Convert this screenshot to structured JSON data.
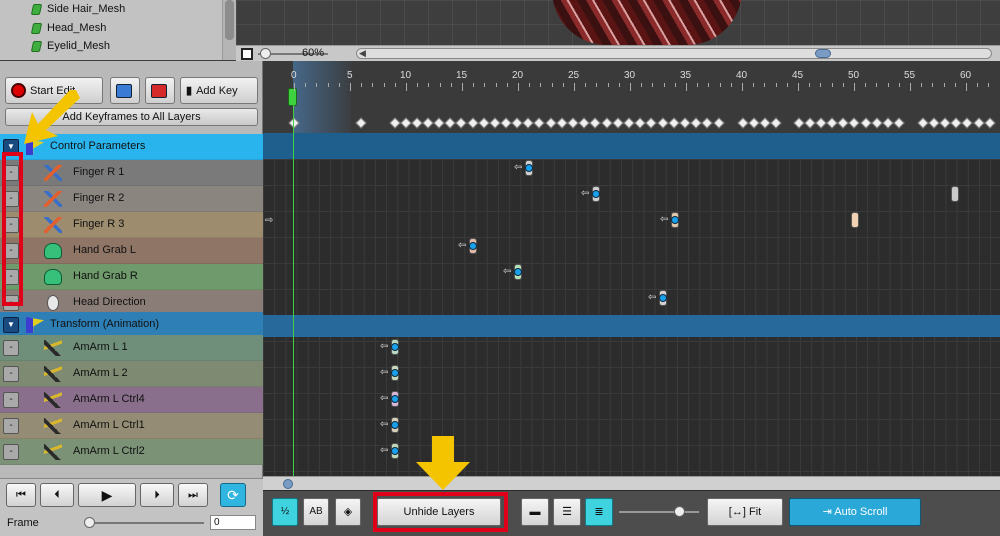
{
  "meshes": [
    "Side Hair_Mesh",
    "Head_Mesh",
    "Eyelid_Mesh"
  ],
  "zoom": "60%",
  "toolbar": {
    "start_edit": "Start Edit",
    "add_key": "Add Key",
    "add_all": "Add Keyframes to All Layers"
  },
  "ruler_ticks": [
    "0",
    "5",
    "10",
    "15",
    "20",
    "25",
    "30",
    "35",
    "40",
    "45",
    "50",
    "55",
    "60"
  ],
  "layers": [
    {
      "label": "Control Parameters",
      "group": true
    },
    {
      "label": "Finger R 1",
      "icon": "finger"
    },
    {
      "label": "Finger R 2",
      "icon": "finger"
    },
    {
      "label": "Finger R 3",
      "icon": "finger"
    },
    {
      "label": "Hand Grab L",
      "icon": "hand"
    },
    {
      "label": "Hand Grab R",
      "icon": "hand"
    },
    {
      "label": "Head Direction",
      "icon": "head"
    },
    {
      "label": "Transform (Animation)",
      "group": true
    },
    {
      "label": "AmArm L 1",
      "icon": "arm"
    },
    {
      "label": "AmArm L 2",
      "icon": "arm"
    },
    {
      "label": "AmArm L Ctrl4",
      "icon": "arm"
    },
    {
      "label": "AmArm L Ctrl1",
      "icon": "arm"
    },
    {
      "label": "AmArm L Ctrl2",
      "icon": "arm"
    }
  ],
  "playback": {
    "frame_label": "Frame",
    "frame_value": "0"
  },
  "bottom": {
    "unhide": "Unhide Layers",
    "fit": "Fit",
    "auto_scroll": "Auto Scroll"
  },
  "colors": {
    "accent": "#2fb5e0",
    "annotation_red": "#e00018",
    "annotation_yellow": "#f5c400"
  }
}
